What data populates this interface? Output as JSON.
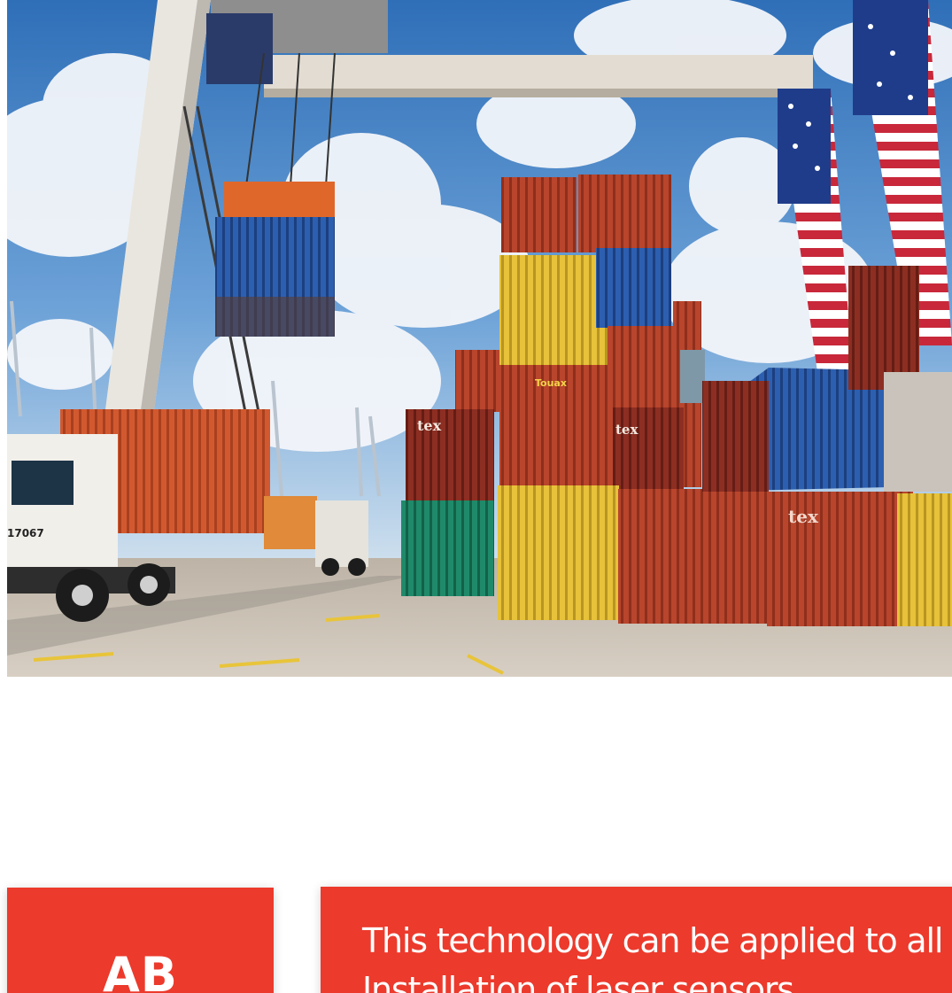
{
  "colors": {
    "accent_red": "#ec3a2c",
    "sky_blue": "#4a86c8",
    "ground": "#c9bfb3"
  },
  "hero": {
    "description_icon": "port-container-yard-photo",
    "container_labels": {
      "touax": "Touax",
      "tex_left": "tex",
      "tex_mid": "tex",
      "tex_right": "tex",
      "truck_number": "17067"
    }
  },
  "cards": {
    "left_label": "AB",
    "right_text": "This technology can be applied to all RTG brands. Installation of laser sensors"
  }
}
